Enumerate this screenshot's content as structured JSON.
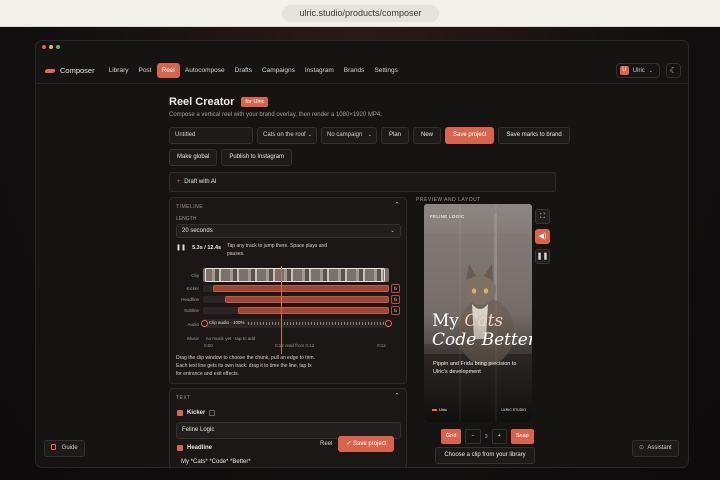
{
  "browser": {
    "url": "ulric.studio/products/composer"
  },
  "nav": {
    "brand": "Composer",
    "links": [
      "Library",
      "Post",
      "Reel",
      "Autocompose",
      "Drafts",
      "Campaigns",
      "Instagram",
      "Brands",
      "Settings"
    ],
    "active": "Reel",
    "user": {
      "initial": "U",
      "name": "Ulric"
    }
  },
  "header": {
    "title": "Reel Creator",
    "badge": "for Ulric",
    "subtitle": "Compose a vertical reel with your brand overlay, then render a 1080×1920 MP4."
  },
  "toolbar": {
    "project_name": "Untitled",
    "clip_select": "Cats on the roof",
    "campaign_select": "No campaign",
    "plan": "Plan",
    "new": "New",
    "save_project": "Save project",
    "save_marks": "Save marks to brand",
    "make_global": "Make global",
    "publish": "Publish to Instagram"
  },
  "ai": {
    "label": "Draft with AI"
  },
  "timeline": {
    "heading": "TIMELINE",
    "length_label": "LENGTH",
    "length_value": "20 seconds",
    "time_readout": "5.3s / 12.4s",
    "tip": "Tap any track to jump there. Space plays and pauses.",
    "tracks": [
      "Clip",
      "Kicker",
      "Headline",
      "Subline",
      "Audio",
      "Music"
    ],
    "audio_text": "Clip audio · 100%",
    "music_text": "no music yet · tap to add",
    "scale": [
      "0:00",
      "0:12 read from 0:12",
      "0:12"
    ],
    "help": "Drag the clip window to choose the chunk, pull an edge to trim. Each text line gets its own track: drag it to time the line, tap fx for entrance and exit effects."
  },
  "text_panel": {
    "heading": "TEXT",
    "kicker_label": "Kicker",
    "kicker_value": "Feline Logic",
    "headline_label": "Headline",
    "headline_value": "My *Cats* *Code* *Better*"
  },
  "floating": {
    "reel": "Reel",
    "save": "Save project"
  },
  "preview": {
    "heading": "PREVIEW AND LAYOUT",
    "kicker": "FELINE LOGIC",
    "headline_line1": "My",
    "headline_cats": "Cats",
    "headline_line2": "Code Better",
    "subline": "Pippin and Frida bring precision to Ulric's development",
    "footer_brand": "Ulric",
    "footer_right": "ULRIC STUDIO",
    "grid": "Grid",
    "minus": "−",
    "grid_count": "3",
    "plus": "+",
    "snap": "Snap",
    "choose_clip": "Choose a clip from your library"
  },
  "corners": {
    "guide": "Guide",
    "assistant": "Assistant"
  },
  "colors": {
    "accent": "#d9644d",
    "bg": "#161313"
  }
}
